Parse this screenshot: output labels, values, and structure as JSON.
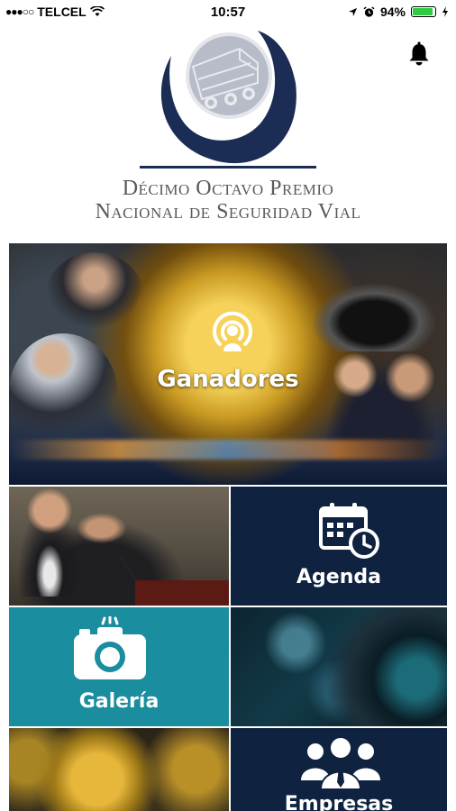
{
  "status_bar": {
    "signal_dots": "●●●○○",
    "carrier": "TELCEL",
    "time": "10:57",
    "battery": "94%",
    "battery_level": 0.94
  },
  "header": {
    "title_line1": "Décimo Octavo Premio",
    "title_line2": "Nacional de Seguridad Vial",
    "colors": {
      "navy": "#1b2c55",
      "title_gray": "#5a5a5a"
    }
  },
  "menu": {
    "ganadores": {
      "label": "Ganadores",
      "icon": "podcast-icon"
    },
    "agenda": {
      "label": "Agenda",
      "icon": "calendar-clock-icon",
      "color": "#0f2340"
    },
    "galeria": {
      "label": "Galería",
      "icon": "camera-icon",
      "color": "#1a8d9f"
    },
    "empresas": {
      "label": "Empresas",
      "icon": "people-group-icon",
      "color": "#0f2340"
    }
  }
}
